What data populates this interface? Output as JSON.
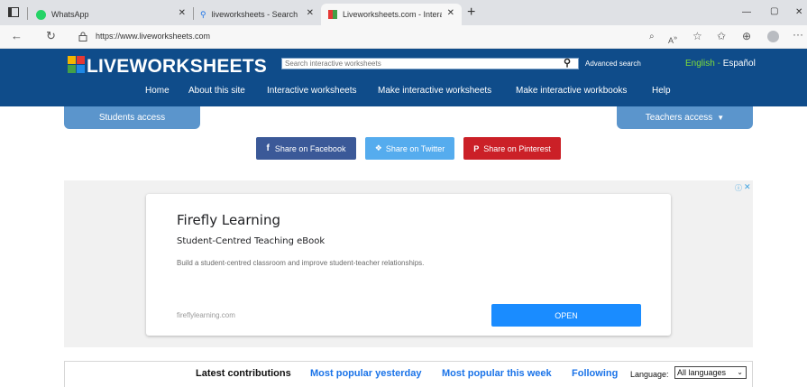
{
  "browser": {
    "tabs": [
      {
        "title": "WhatsApp"
      },
      {
        "title": "liveworksheets - Search"
      },
      {
        "title": "Liveworksheets.com - Interactive"
      }
    ],
    "new_tab": "+",
    "url": "https://www.liveworksheets.com",
    "window_controls": {
      "minimize": "—",
      "restore": "▢",
      "close": "✕"
    },
    "icons": [
      "sidebar-icon",
      "whatsapp-icon",
      "search-icon",
      "liveworksheets-favicon",
      "back-icon",
      "refresh-icon",
      "lock-icon",
      "reader-icon",
      "read-aloud-icon",
      "favorite-icon",
      "favorites-icon",
      "collections-icon",
      "profile-icon",
      "more-icon"
    ]
  },
  "site": {
    "logo_text": "LIVEWORKSHEETS",
    "search_placeholder": "Search interactive worksheets",
    "advanced_search": "Advanced search",
    "lang_english": "English",
    "lang_sep": " - ",
    "lang_spanish": "Español",
    "nav": [
      "Home",
      "About this site",
      "Interactive worksheets",
      "Make interactive worksheets",
      "Make interactive workbooks",
      "Help"
    ],
    "students_access": "Students access",
    "teachers_access": "Teachers access",
    "share": {
      "facebook": "Share on Facebook",
      "twitter": "Share on Twitter",
      "pinterest": "Share on Pinterest"
    },
    "colors": {
      "header": "#0f4c8a",
      "access": "#5b95cc",
      "facebook": "#3b5998",
      "twitter": "#55acee",
      "pinterest": "#cb2027",
      "link_blue": "#1a73e8",
      "open_btn": "#1a8cff"
    }
  },
  "ad": {
    "title": "Firefly Learning",
    "subtitle": "Student-Centred Teaching eBook",
    "description": "Build a student-centred classroom and improve student-teacher relationships.",
    "domain": "fireflylearning.com",
    "cta": "OPEN"
  },
  "contributions": {
    "latest": "Latest contributions",
    "yesterday": "Most popular yesterday",
    "week": "Most popular this week",
    "following": "Following",
    "language_label": "Language:",
    "language_value": "All languages"
  }
}
